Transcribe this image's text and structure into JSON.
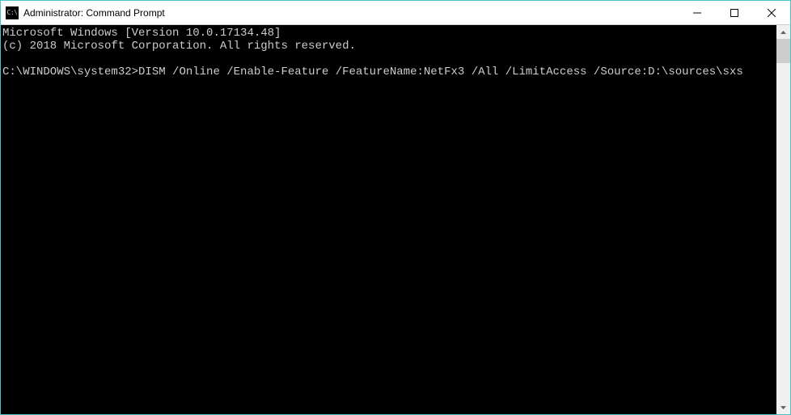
{
  "window": {
    "title": "Administrator: Command Prompt",
    "icon_label": "C:\\"
  },
  "terminal": {
    "line1": "Microsoft Windows [Version 10.0.17134.48]",
    "line2": "(c) 2018 Microsoft Corporation. All rights reserved.",
    "blank": "",
    "prompt": "C:\\WINDOWS\\system32>",
    "command": "DISM /Online /Enable-Feature /FeatureName:NetFx3 /All /LimitAccess /Source:D:\\sources\\sxs"
  }
}
